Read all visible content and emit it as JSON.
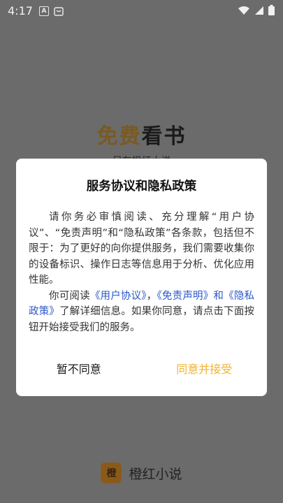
{
  "status_bar": {
    "time": "4:17",
    "notification_icon_a": "A"
  },
  "splash": {
    "title_accent": "免费",
    "title_rest": "看书",
    "subtitle": "尽在橙红小说"
  },
  "brand": {
    "logo_text": "橙",
    "name": "橙红小说"
  },
  "dialog": {
    "title": "服务协议和隐私政策",
    "paragraph1": "请你务必审慎阅读、充分理解“用户协议”、“免责声明”和“隐私政策”各条款，包括但不限于：为了更好的向你提供服务，我们需要收集你的设备标识、操作日志等信息用于分析、优化应用性能。",
    "p2_prefix": "你可阅读",
    "link_user_agreement": "《用户协议》",
    "p2_sep1": "，",
    "link_disclaimer": "《免责声明》",
    "p2_and": "和",
    "link_privacy": "《隐私政策》",
    "p2_suffix": "了解详细信息。如果你同意，请点击下面按钮开始接受我们的服务。",
    "decline_label": "暂不同意",
    "accept_label": "同意并接受"
  },
  "colors": {
    "accent": "#f2b230",
    "link": "#2a57c9",
    "overlay": "#6b6b6b"
  }
}
